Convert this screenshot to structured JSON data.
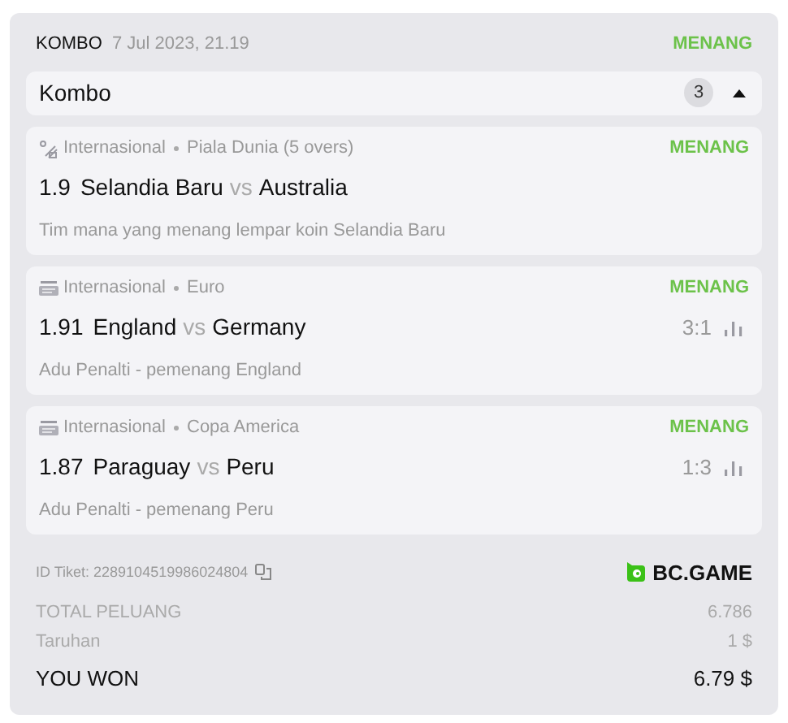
{
  "header": {
    "type": "KOMBO",
    "date": "7 Jul 2023, 21.19",
    "status": "MENANG"
  },
  "section": {
    "title": "Kombo",
    "count": "3",
    "expanded": true
  },
  "events": [
    {
      "kind": "cricket",
      "category": "Internasional",
      "league": "Piala Dunia (5 overs)",
      "status": "MENANG",
      "odds": "1.9",
      "home": "Selandia Baru",
      "vs": "vs",
      "away": "Australia",
      "bet": "Tim mana yang menang lempar koin Selandia Baru"
    },
    {
      "kind": "fifa",
      "category": "Internasional",
      "league": "Euro",
      "status": "MENANG",
      "odds": "1.91",
      "home": "England",
      "vs": "vs",
      "away": "Germany",
      "score": "3:1",
      "bet": "Adu Penalti - pemenang England"
    },
    {
      "kind": "fifa",
      "category": "Internasional",
      "league": "Copa America",
      "status": "MENANG",
      "odds": "1.87",
      "home": "Paraguay",
      "vs": "vs",
      "away": "Peru",
      "score": "1:3",
      "bet": "Adu Penalti - pemenang Peru"
    }
  ],
  "ticket": {
    "label": "ID Tiket:",
    "id": "2289104519986024804"
  },
  "brand": "BC.GAME",
  "summary": [
    {
      "kind": "muted",
      "label": "TOTAL PELUANG",
      "value": "6.786"
    },
    {
      "kind": "muted",
      "label": "Taruhan",
      "value": "1 $"
    },
    {
      "kind": "total",
      "label": "YOU WON",
      "value": "6.79 $"
    }
  ]
}
